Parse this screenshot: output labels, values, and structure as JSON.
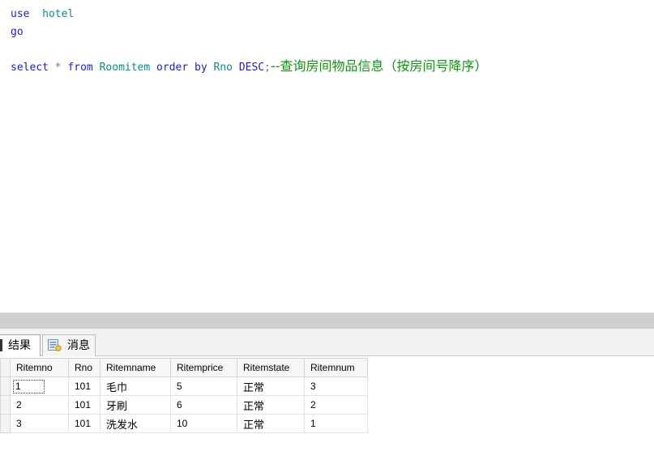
{
  "editor": {
    "line1": {
      "kw": "use",
      "id": "hotel"
    },
    "line2": {
      "kw": "go"
    },
    "line4": {
      "kw_select": "select",
      "star": "*",
      "kw_from": "from",
      "table": "Roomitem",
      "kw_order_by": "order by",
      "column": "Rno",
      "kw_desc": "DESC",
      "semicolon": ";",
      "comment": "--查询房间物品信息（按房间号降序）"
    }
  },
  "results_tabs": {
    "results_label": "结果",
    "messages_label": "消息"
  },
  "grid": {
    "columns": [
      "Ritemno",
      "Rno",
      "Ritemname",
      "Ritemprice",
      "Ritemstate",
      "Ritemnum"
    ],
    "rows": [
      [
        "1",
        "101",
        "毛巾",
        "5",
        "正常",
        "3"
      ],
      [
        "2",
        "101",
        "牙刷",
        "6",
        "正常",
        "2"
      ],
      [
        "3",
        "101",
        "洗发水",
        "10",
        "正常",
        "1"
      ]
    ]
  },
  "colors": {
    "keyword": "#1e1ebf",
    "identifier": "#0f8a8a",
    "comment": "#129212",
    "splitter": "#cfcfcf"
  }
}
